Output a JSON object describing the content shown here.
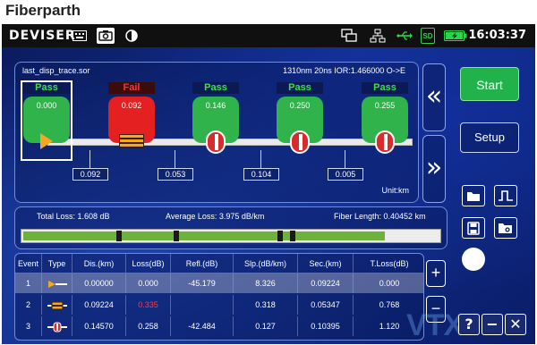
{
  "page_title": "Fiberparth",
  "statusbar": {
    "brand": "DEVISER",
    "time": "16:03:37",
    "icons": [
      "keyboard-icon",
      "camera-icon",
      "contrast-icon",
      "remote-desktop-icon",
      "network-icon",
      "usb-icon",
      "sd-card-icon",
      "battery-charging-icon"
    ],
    "sd_label": "SD"
  },
  "trace": {
    "filename": "last_disp_trace.sor",
    "params": "1310nm 20ns IOR:1.466000 O->E",
    "unit": "Unit:km",
    "events": [
      {
        "status": "Pass",
        "value": "0.000",
        "type": "launch"
      },
      {
        "status": "Fail",
        "value": "0.092",
        "type": "splice"
      },
      {
        "status": "Pass",
        "value": "0.146",
        "type": "connector"
      },
      {
        "status": "Pass",
        "value": "0.250",
        "type": "connector"
      },
      {
        "status": "Pass",
        "value": "0.255",
        "type": "connector"
      }
    ],
    "distances": [
      "0.092",
      "0.053",
      "0.104",
      "0.005"
    ]
  },
  "summary": {
    "total_loss": "Total Loss: 1.608 dB",
    "average_loss": "Average Loss: 3.975 dB/km",
    "fiber_length": "Fiber Length: 0.40452 km"
  },
  "table": {
    "headers": [
      "Event",
      "Type",
      "Dis.(km)",
      "Loss(dB)",
      "Refl.(dB)",
      "Slp.(dB/km)",
      "Sec.(km)",
      "T.Loss(dB)"
    ],
    "rows": [
      {
        "event": "1",
        "type": "launch",
        "dis": "0.00000",
        "loss": "0.000",
        "refl": "-45.179",
        "slp": "8.326",
        "sec": "0.09224",
        "tloss": "0.000",
        "loss_red": false
      },
      {
        "event": "2",
        "type": "splice",
        "dis": "0.09224",
        "loss": "0.335",
        "refl": "",
        "slp": "0.318",
        "sec": "0.05347",
        "tloss": "0.768",
        "loss_red": true
      },
      {
        "event": "3",
        "type": "connector",
        "dis": "0.14570",
        "loss": "0.258",
        "refl": "-42.484",
        "slp": "0.127",
        "sec": "0.10395",
        "tloss": "1.120",
        "loss_red": false
      }
    ]
  },
  "controls": {
    "start": "Start",
    "setup": "Setup",
    "prev": "«",
    "next": "»",
    "zoom_in": "+",
    "zoom_out": "−",
    "help": "?",
    "minimize": "−",
    "close": "✕"
  },
  "watermark": "VTX",
  "colors": {
    "pass": "#2fb34a",
    "fail": "#e42020",
    "start": "#21b24b",
    "splice_loss_red": "#ff3b3b"
  }
}
